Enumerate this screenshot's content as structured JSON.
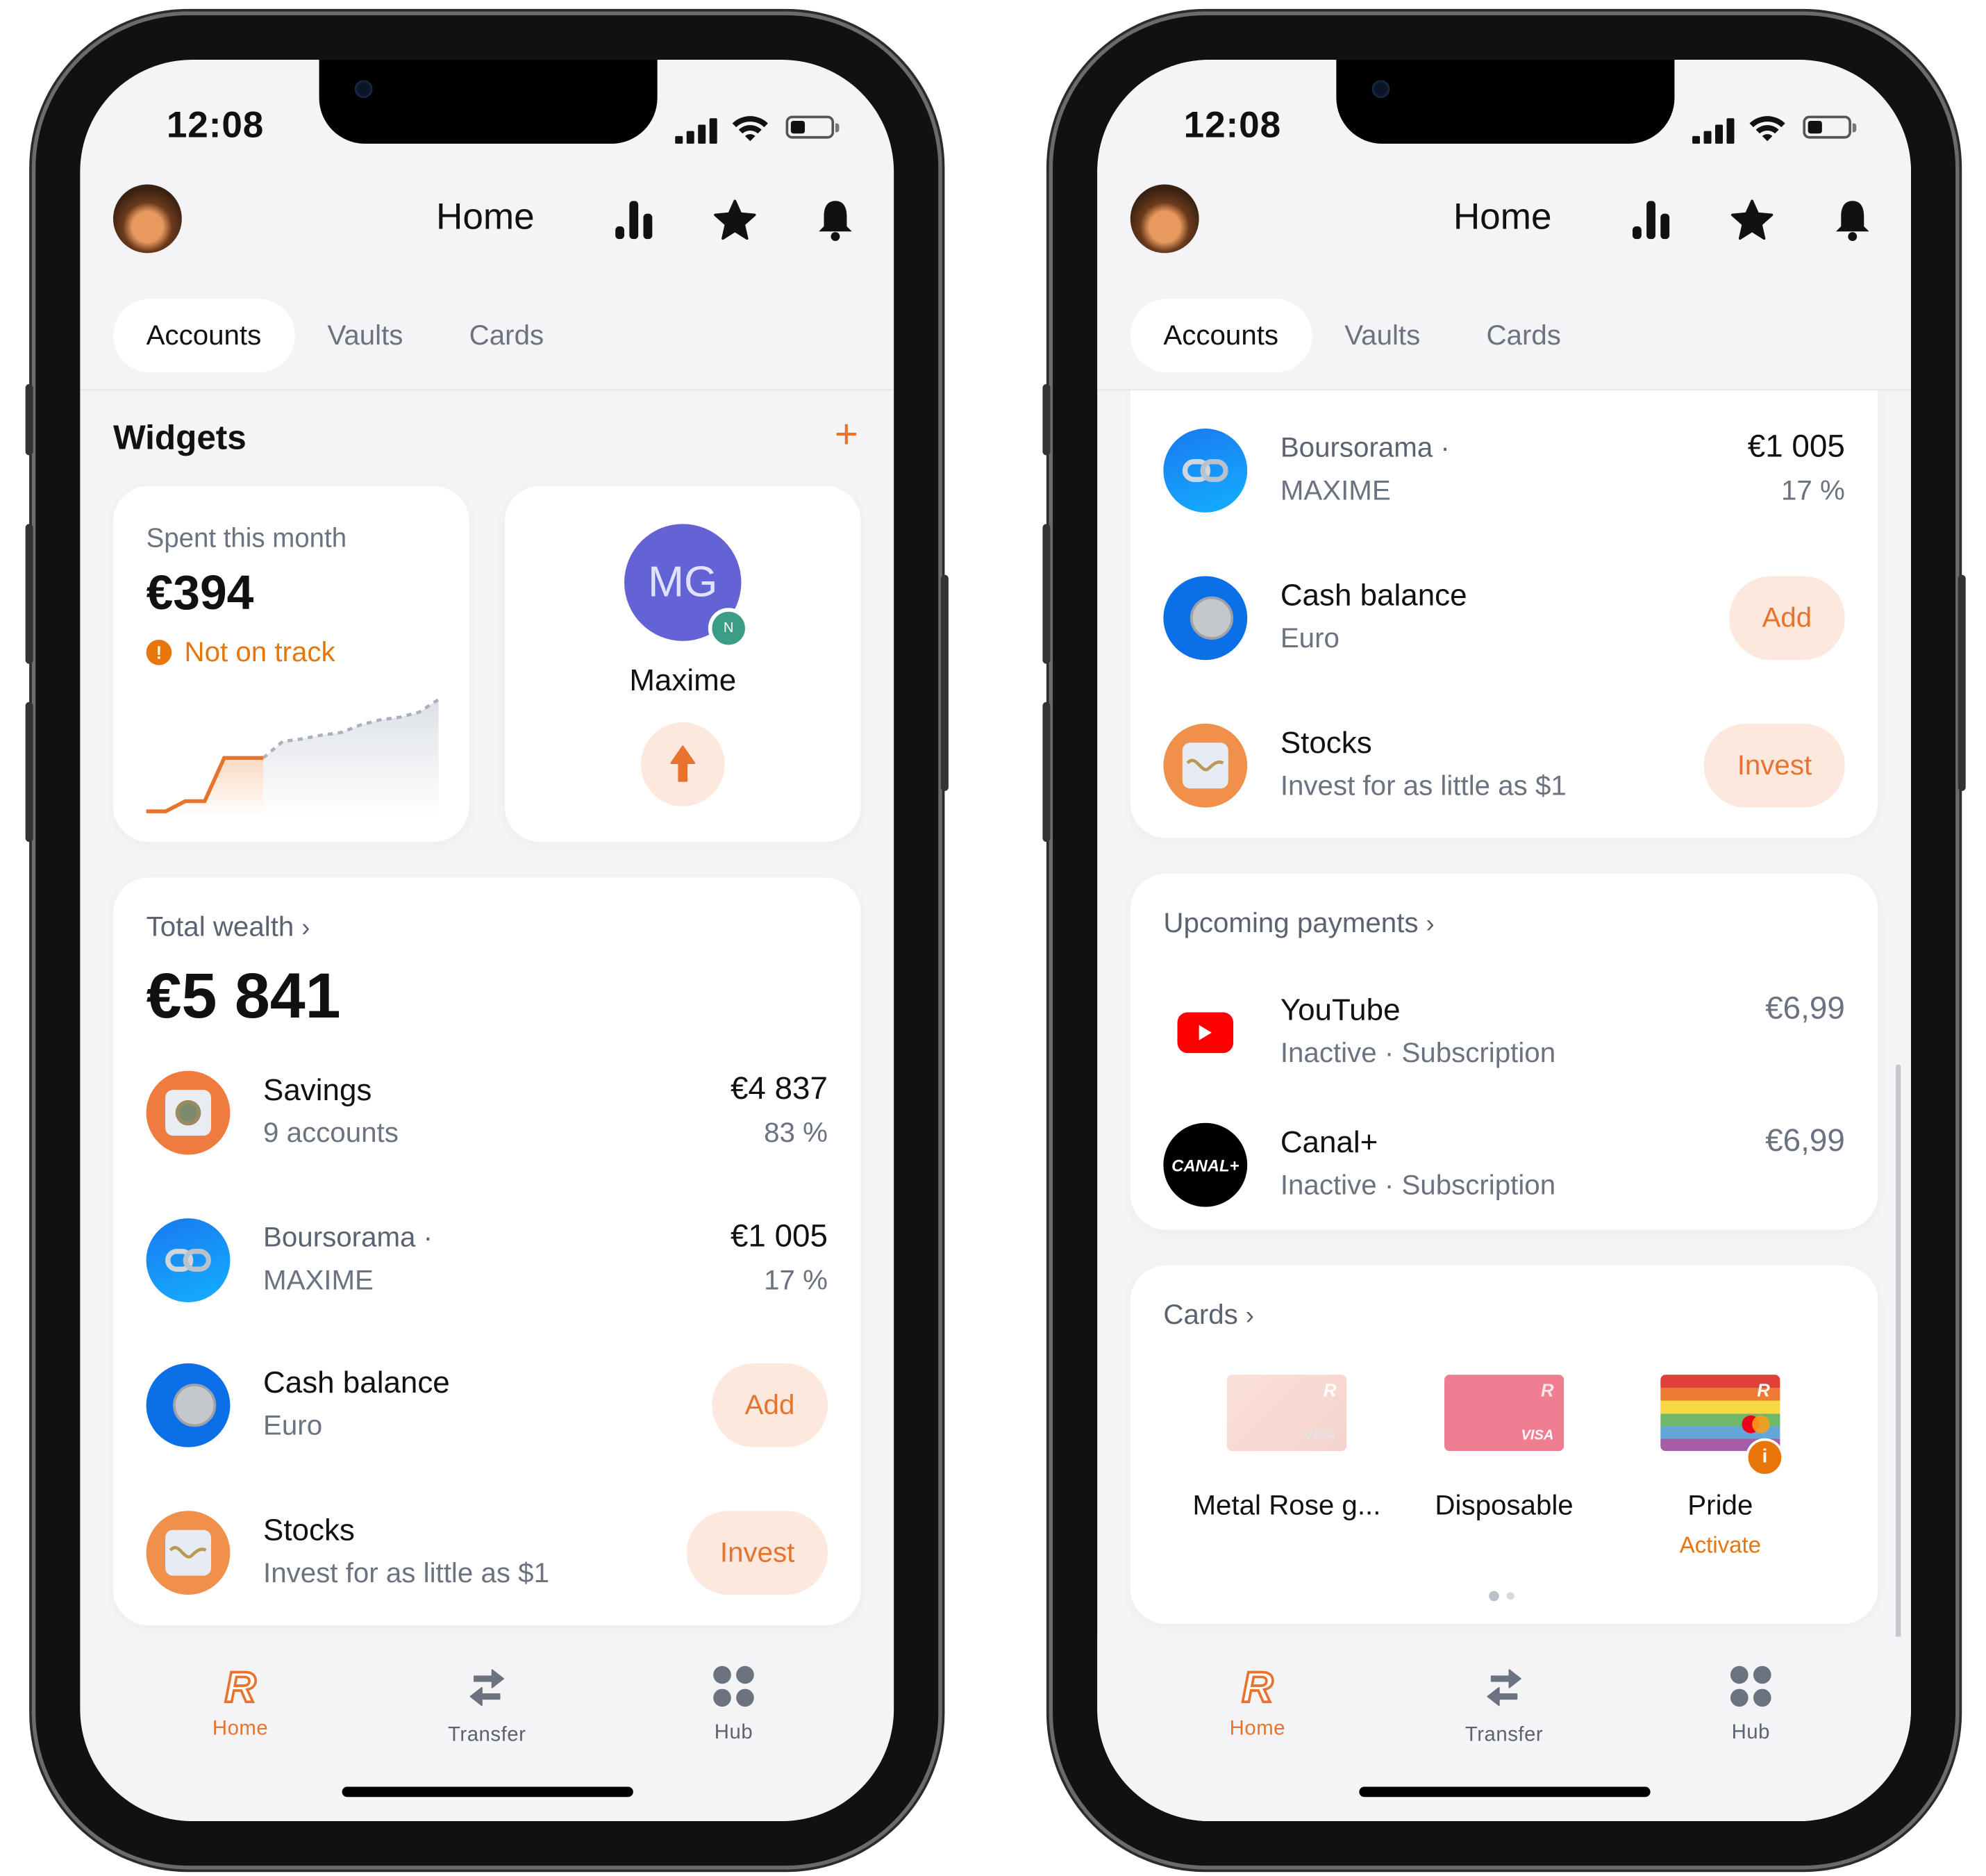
{
  "status_bar": {
    "time": "12:08"
  },
  "header": {
    "title": "Home"
  },
  "tabs": [
    {
      "label": "Accounts",
      "active": true
    },
    {
      "label": "Vaults",
      "active": false
    },
    {
      "label": "Cards",
      "active": false
    }
  ],
  "widgets": {
    "title": "Widgets",
    "spent": {
      "label": "Spent this month",
      "amount": "€394",
      "status": "Not on track",
      "chart_data": {
        "type": "line",
        "title": "Spent this month",
        "actual": [
          0,
          0,
          0.08,
          0.08,
          0.42,
          0.42,
          0.42
        ],
        "projected": [
          0.42,
          0.55,
          0.57,
          0.6,
          0.62,
          0.68,
          0.72,
          0.74,
          0.78,
          0.88
        ],
        "colors": {
          "actual": "#e8732c",
          "projected": "#aab1bb"
        }
      }
    },
    "contact": {
      "initials": "MG",
      "name": "Maxime",
      "avatar_color": "#6463d6",
      "badge_color": "#3a9e86"
    }
  },
  "wealth": {
    "title": "Total wealth",
    "amount": "€5 841",
    "accounts": [
      {
        "name": "Savings",
        "sub": "9 accounts",
        "value": "€4 837",
        "share": "83 %",
        "icon": "safe-icon",
        "color": "#ef7b3e"
      },
      {
        "name": "Boursorama ·",
        "sub": "MAXIME",
        "value": "€1 005",
        "share": "17 %",
        "icon": "link-icon",
        "color": "#1a8cf0"
      },
      {
        "name": "Cash balance",
        "sub": "Euro",
        "action": "Add",
        "icon": "coins-icon",
        "color": "#0b6fe8"
      },
      {
        "name": "Stocks",
        "sub": "Invest for as little as $1",
        "action": "Invest",
        "icon": "stocks-icon",
        "color": "#f0904a"
      }
    ]
  },
  "upcoming": {
    "title": "Upcoming payments",
    "items": [
      {
        "name": "YouTube",
        "sub": "Inactive · Subscription",
        "amount": "€6,99",
        "icon": "youtube-icon"
      },
      {
        "name": "Canal+",
        "sub": "Inactive · Subscription",
        "amount": "€6,99",
        "icon": "canal-plus-icon",
        "logo_text": "CANAL+"
      }
    ]
  },
  "cards_section": {
    "title": "Cards",
    "cards": [
      {
        "name": "Metal Rose g...",
        "network": "VISA"
      },
      {
        "name": "Disposable",
        "network": "VISA"
      },
      {
        "name": "Pride",
        "action": "Activate"
      }
    ],
    "pagination": {
      "pages": 2,
      "current": 1
    }
  },
  "nav": [
    {
      "label": "Home",
      "active": true
    },
    {
      "label": "Transfer",
      "active": false
    },
    {
      "label": "Hub",
      "active": false
    }
  ],
  "colors": {
    "accent": "#e8732c",
    "accent_soft": "#fde8de",
    "text": "#111111",
    "muted": "#6b7280",
    "background": "#f4f4f6"
  }
}
